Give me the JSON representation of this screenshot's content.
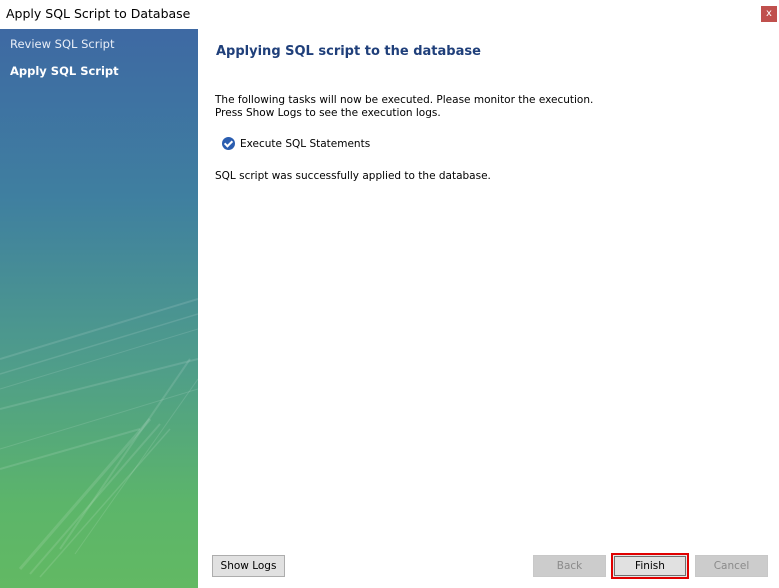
{
  "window": {
    "title": "Apply SQL Script to Database",
    "close_label": "x"
  },
  "sidebar": {
    "steps": [
      {
        "label": "Review SQL Script"
      },
      {
        "label": "Apply SQL Script"
      }
    ]
  },
  "main": {
    "heading": "Applying SQL script to the database",
    "description_line1": "The following tasks will now be executed. Please monitor the execution.",
    "description_line2": "Press Show Logs to see the execution logs.",
    "task_label": "Execute SQL Statements",
    "result": "SQL script was successfully applied to the database."
  },
  "footer": {
    "show_logs_label": "Show Logs",
    "back_label": "Back",
    "finish_label": "Finish",
    "cancel_label": "Cancel"
  },
  "colors": {
    "heading": "#1f3f7a",
    "highlight_border": "#e00000",
    "sidebar_top": "#3e69a3",
    "sidebar_bottom": "#62b963"
  }
}
